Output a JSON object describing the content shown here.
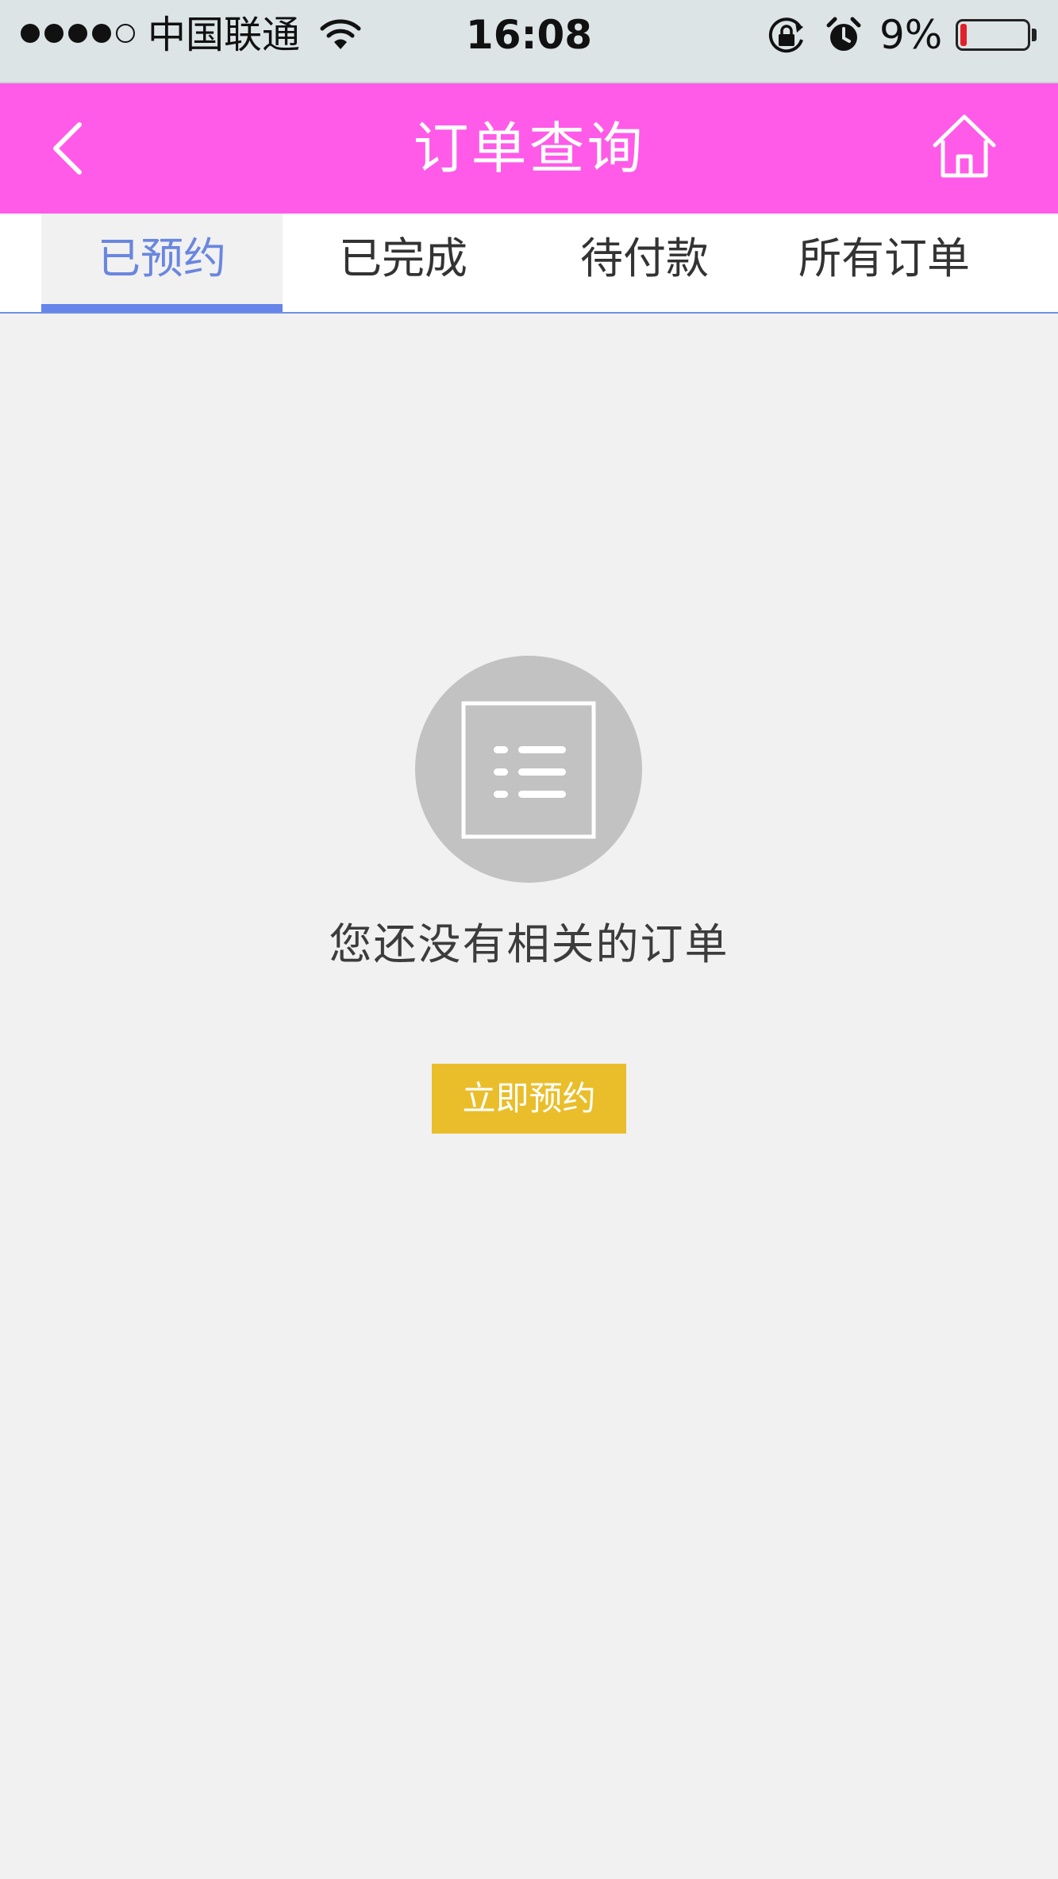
{
  "status_bar": {
    "carrier": "中国联通",
    "time": "16:08",
    "battery_percent_label": "9%",
    "battery_level": 0.09,
    "signal_bars_filled": 4,
    "signal_bars_total": 5,
    "icons": [
      "signal-dots",
      "wifi-icon",
      "rotation-lock-icon",
      "alarm-icon",
      "battery-icon"
    ]
  },
  "header": {
    "title": "订单查询",
    "background_color": "#ff5ae8",
    "left_icon": "back-chevron-icon",
    "right_icon": "home-icon"
  },
  "tabs": [
    {
      "label": "已预约",
      "active": true
    },
    {
      "label": "已完成",
      "active": false
    },
    {
      "label": "待付款",
      "active": false
    },
    {
      "label": "所有订单",
      "active": false
    }
  ],
  "tab_active_color": "#6585eb",
  "empty_state": {
    "icon": "order-list-icon",
    "message": "您还没有相关的订单",
    "button_label": "立即预约",
    "button_color": "#e9be2a"
  }
}
